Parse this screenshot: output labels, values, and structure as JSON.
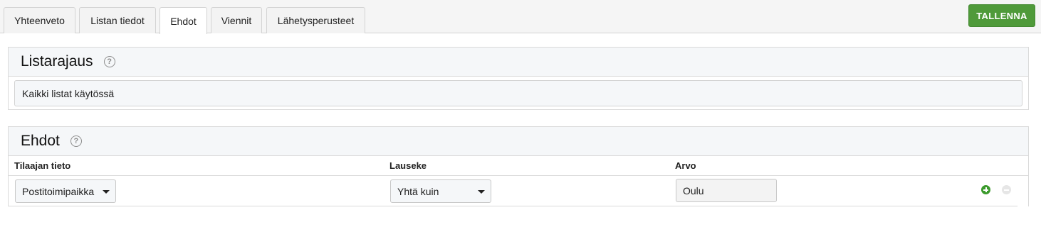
{
  "tabs": [
    {
      "label": "Yhteenveto",
      "active": false
    },
    {
      "label": "Listan tiedot",
      "active": false
    },
    {
      "label": "Ehdot",
      "active": true
    },
    {
      "label": "Viennit",
      "active": false
    },
    {
      "label": "Lähetysperusteet",
      "active": false
    }
  ],
  "save_button": {
    "label": "TALLENNA",
    "color": "#4f9a3a"
  },
  "list_scope": {
    "title": "Listarajaus",
    "help_icon": "question-circle-icon",
    "value": "Kaikki listat käytössä"
  },
  "conditions": {
    "title": "Ehdot",
    "help_icon": "question-circle-icon",
    "columns": {
      "field": "Tilaajan tieto",
      "operator": "Lauseke",
      "value": "Arvo"
    },
    "rows": [
      {
        "field": "Postitoimipaikka",
        "operator": "Yhtä kuin",
        "value": "Oulu",
        "add_icon": "plus-circle-icon",
        "remove_icon": "minus-circle-icon"
      }
    ]
  }
}
